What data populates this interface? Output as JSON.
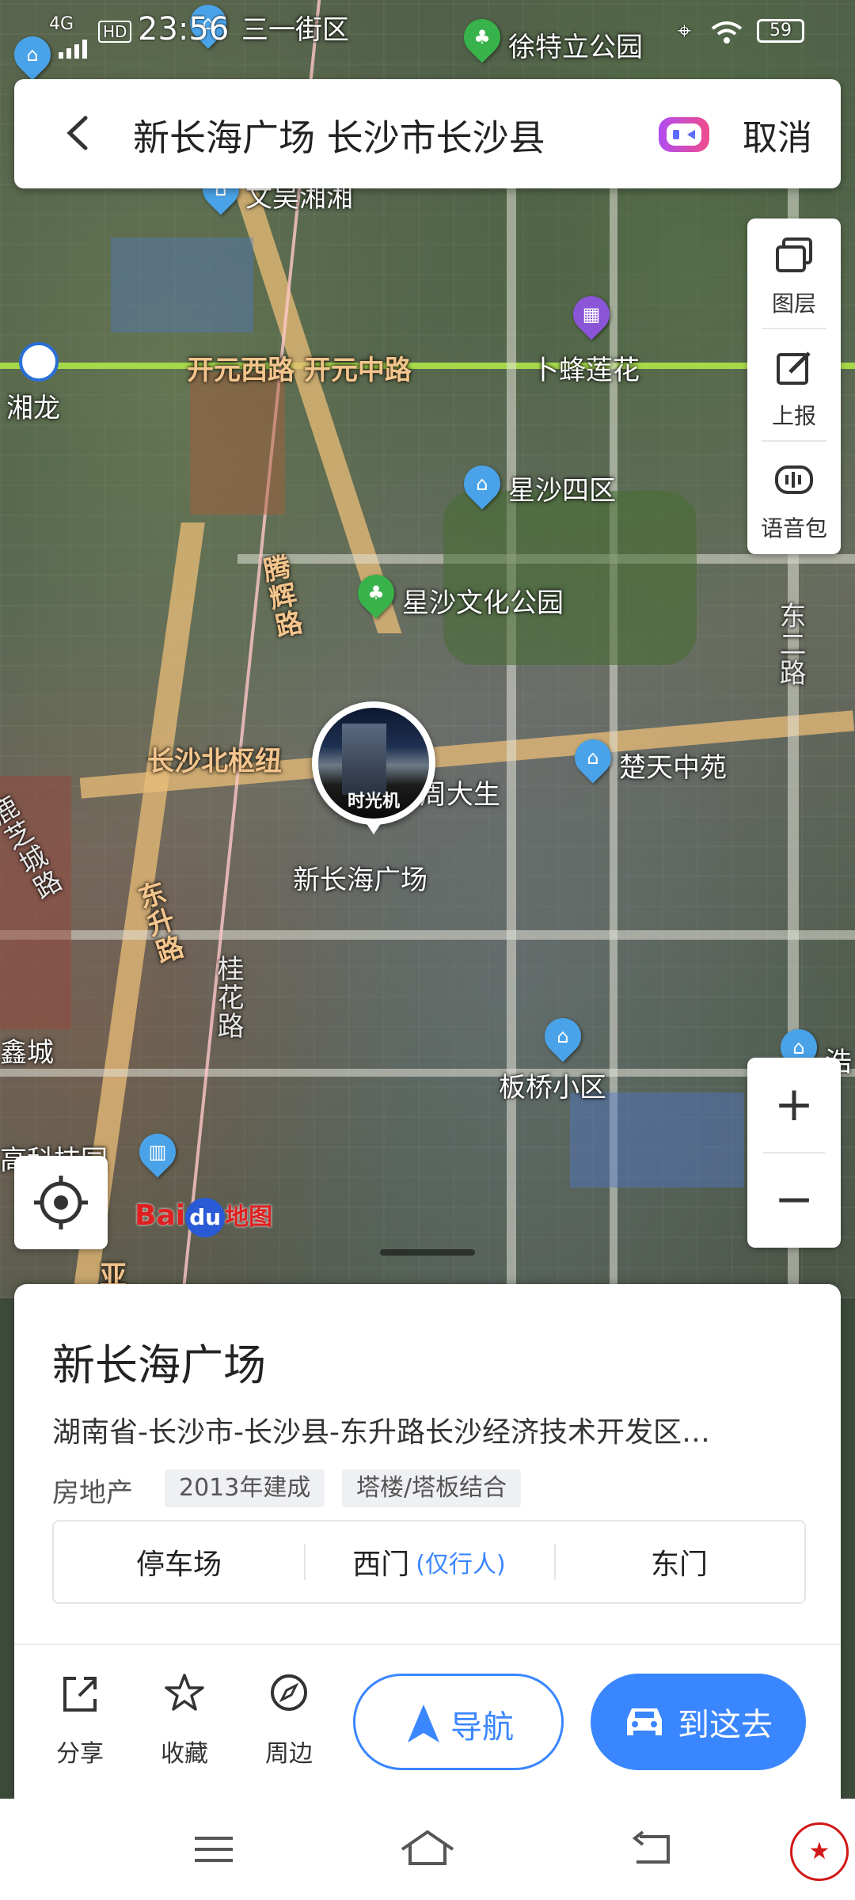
{
  "status_bar": {
    "network": "4G",
    "hd": "HD",
    "time": "23:56",
    "battery": "59"
  },
  "search": {
    "query": "新长海广场 长沙市长沙县",
    "cancel_label": "取消"
  },
  "tools": {
    "layers_label": "图层",
    "report_label": "上报",
    "voice_label": "语音包"
  },
  "map_labels": {
    "poi_top_left": "三一街区",
    "park_top": "徐特立公园",
    "district_top": "文吴湘湘",
    "road_kaiyuan": "开元西路 开元中路",
    "lotus": "卜蜂莲花",
    "xianglong": "湘龙",
    "xingsha4": "星沙四区",
    "tenghui_road": "腾辉路",
    "culture_park": "星沙文化公园",
    "east2_road": "东二路",
    "north_hub": "长沙北枢纽",
    "zhoudasheng": "周大生",
    "chutian": "楚天中苑",
    "selected_poi": "新长海广场",
    "dongsheng_road": "东升路",
    "guihua_road": "桂花路",
    "lucheng": "鹿芝城路",
    "banqiao": "板桥小区",
    "xiangcheng": "鑫城",
    "hightech": "高科技园",
    "right_edge": "浩",
    "bottom_ya": "亚"
  },
  "time_machine": {
    "label": "时光机"
  },
  "baidu_logo": {
    "text_bai": "Bai",
    "text_du": "du",
    "text_map": "地图"
  },
  "zoom": {
    "plus": "+",
    "minus": "−"
  },
  "card": {
    "title": "新长海广场",
    "address": "湖南省-长沙市-长沙县-东升路长沙经济技术开发区…",
    "category": "房地产",
    "tags": [
      "2013年建成",
      "塔楼/塔板结合"
    ],
    "entrances": [
      {
        "label": "停车场",
        "sub": ""
      },
      {
        "label": "西门",
        "sub": "(仅行人)"
      },
      {
        "label": "东门",
        "sub": ""
      }
    ],
    "actions": {
      "share": "分享",
      "favorite": "收藏",
      "nearby": "周边",
      "navigate": "导航",
      "go_here": "到这去"
    }
  },
  "colors": {
    "accent": "#3a86ff",
    "kaiyuan_road": "#a6d94a"
  }
}
